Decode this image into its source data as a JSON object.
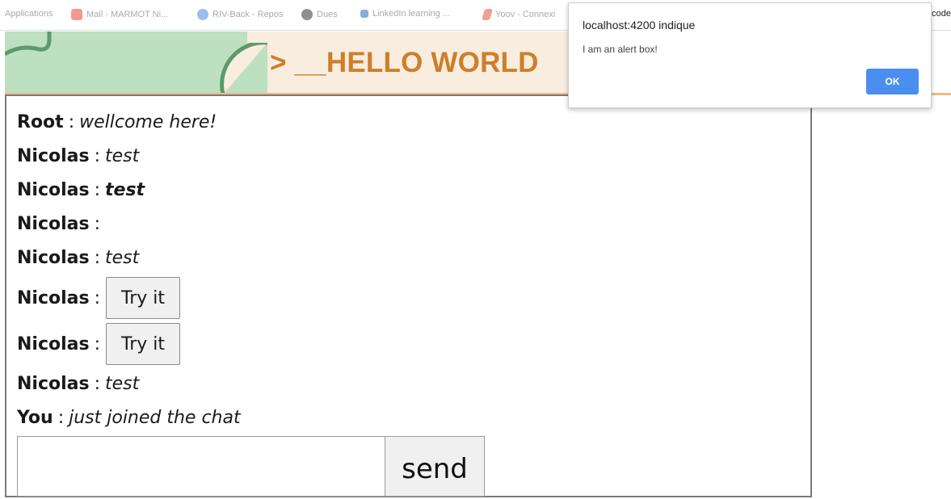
{
  "bookmarks": {
    "items": [
      {
        "label": "Applications",
        "color": "#9aa0a6"
      },
      {
        "label": "Mail - MARMOT Ni...",
        "color": "#e8453c"
      },
      {
        "label": "RIV-Back - Repos",
        "color": "#4a86e8"
      },
      {
        "label": "Dues",
        "color": "#333333"
      },
      {
        "label": "LinkedIn learning ...",
        "color": "#2d64bc"
      },
      {
        "label": "Yoov - Connexi",
        "color": "#e0563b"
      }
    ],
    "overflow_text": "code"
  },
  "banner": {
    "title": "> __HELLO WORLD",
    "colors": {
      "background": "#f8eddf",
      "title": "#cd7f2a",
      "leaf": "#bde0c1",
      "arc": "#5c9a6b"
    }
  },
  "chat": {
    "messages": [
      {
        "author": "Root",
        "separator": ":",
        "text": "wellcome here!"
      },
      {
        "author": "Nicolas",
        "separator": ":",
        "text": "test"
      },
      {
        "author": "Nicolas",
        "separator": ":",
        "text": "test"
      },
      {
        "author": "Nicolas",
        "separator": ":",
        "text": ""
      },
      {
        "author": "Nicolas",
        "separator": ":",
        "text": "test"
      },
      {
        "author": "Nicolas",
        "separator": ":",
        "button_label": "Try it"
      },
      {
        "author": "Nicolas",
        "separator": ":",
        "button_label": "Try it"
      },
      {
        "author": "Nicolas",
        "separator": ":",
        "text": "test"
      },
      {
        "author": "You",
        "separator": ":",
        "text": "just joined the chat"
      }
    ],
    "input_value": "",
    "send_label": "send"
  },
  "alert": {
    "title": "localhost:4200 indique",
    "message": "I am an alert box!",
    "ok_label": "OK",
    "accent": "#4a8ef0"
  }
}
